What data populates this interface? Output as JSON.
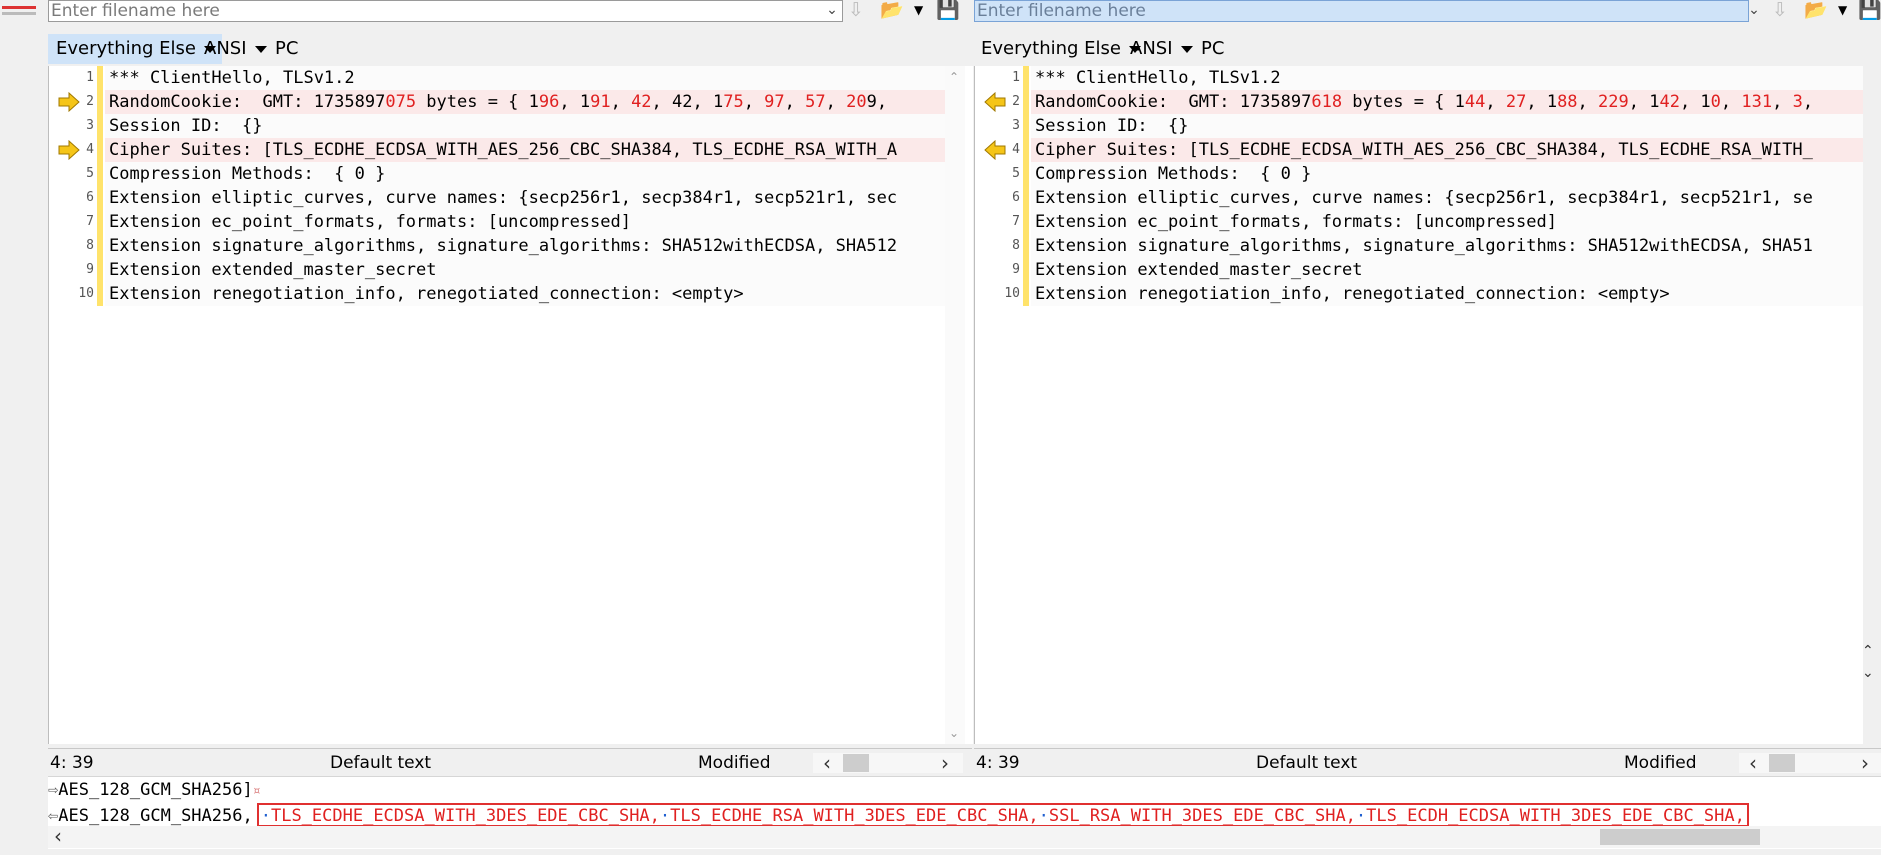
{
  "left": {
    "filename_placeholder": "Enter filename here",
    "filter": "Everything Else",
    "encoding": "ANSI",
    "line_endings": "PC",
    "status": {
      "position": "4: 39",
      "syntax": "Default text",
      "state": "Modified"
    },
    "lines": [
      {
        "num": "1",
        "segments": [
          {
            "t": "*** ClientHello, TLSv1.2",
            "r": false
          }
        ],
        "diff": false
      },
      {
        "num": "2",
        "segments": [
          {
            "t": "RandomCookie:  GMT: 1735897",
            "r": false
          },
          {
            "t": "075",
            "r": true
          },
          {
            "t": " bytes = { 1",
            "r": false
          },
          {
            "t": "96",
            "r": true
          },
          {
            "t": ", 1",
            "r": false
          },
          {
            "t": "91",
            "r": true
          },
          {
            "t": ", ",
            "r": false
          },
          {
            "t": "42",
            "r": true
          },
          {
            "t": ", 42, 1",
            "r": false
          },
          {
            "t": "75",
            "r": true
          },
          {
            "t": ", ",
            "r": false
          },
          {
            "t": "97",
            "r": true
          },
          {
            "t": ", ",
            "r": false
          },
          {
            "t": "57",
            "r": true
          },
          {
            "t": ", ",
            "r": false
          },
          {
            "t": "20",
            "r": true
          },
          {
            "t": "9,",
            "r": false
          }
        ],
        "diff": true
      },
      {
        "num": "3",
        "segments": [
          {
            "t": "Session ID:  {}",
            "r": false
          }
        ],
        "diff": false
      },
      {
        "num": "4",
        "segments": [
          {
            "t": "Cipher Suites: [TLS_ECDHE_ECDSA_WITH_AES_256_CBC_SHA384, TLS_ECDHE_RSA_WITH_A",
            "r": false
          }
        ],
        "diff": true
      },
      {
        "num": "5",
        "segments": [
          {
            "t": "Compression Methods:  { 0 }",
            "r": false
          }
        ],
        "diff": false
      },
      {
        "num": "6",
        "segments": [
          {
            "t": "Extension elliptic_curves, curve names: {secp256r1, secp384r1, secp521r1, sec",
            "r": false
          }
        ],
        "diff": false
      },
      {
        "num": "7",
        "segments": [
          {
            "t": "Extension ec_point_formats, formats: [uncompressed]",
            "r": false
          }
        ],
        "diff": false
      },
      {
        "num": "8",
        "segments": [
          {
            "t": "Extension signature_algorithms, signature_algorithms: SHA512withECDSA, SHA512",
            "r": false
          }
        ],
        "diff": false
      },
      {
        "num": "9",
        "segments": [
          {
            "t": "Extension extended_master_secret",
            "r": false
          }
        ],
        "diff": false
      },
      {
        "num": "10",
        "segments": [
          {
            "t": "Extension renegotiation_info, renegotiated_connection: <empty>",
            "r": false
          }
        ],
        "diff": false
      }
    ]
  },
  "right": {
    "filename_placeholder": "Enter filename here",
    "filter": "Everything Else",
    "encoding": "ANSI",
    "line_endings": "PC",
    "status": {
      "position": "4: 39",
      "syntax": "Default text",
      "state": "Modified"
    },
    "lines": [
      {
        "num": "1",
        "segments": [
          {
            "t": "*** ClientHello, TLSv1.2",
            "r": false
          }
        ],
        "diff": false
      },
      {
        "num": "2",
        "segments": [
          {
            "t": "RandomCookie:  GMT: 1735897",
            "r": false
          },
          {
            "t": "618",
            "r": true
          },
          {
            "t": " bytes = { 1",
            "r": false
          },
          {
            "t": "44",
            "r": true
          },
          {
            "t": ", ",
            "r": false
          },
          {
            "t": "27",
            "r": true
          },
          {
            "t": ", 1",
            "r": false
          },
          {
            "t": "88",
            "r": true
          },
          {
            "t": ", ",
            "r": false
          },
          {
            "t": "229",
            "r": true
          },
          {
            "t": ", 1",
            "r": false
          },
          {
            "t": "42",
            "r": true
          },
          {
            "t": ", 1",
            "r": false
          },
          {
            "t": "0",
            "r": true
          },
          {
            "t": ", ",
            "r": false
          },
          {
            "t": "131",
            "r": true
          },
          {
            "t": ", ",
            "r": false
          },
          {
            "t": "3",
            "r": true
          },
          {
            "t": ",",
            "r": false
          }
        ],
        "diff": true
      },
      {
        "num": "3",
        "segments": [
          {
            "t": "Session ID:  {}",
            "r": false
          }
        ],
        "diff": false
      },
      {
        "num": "4",
        "segments": [
          {
            "t": "Cipher Suites: [TLS_ECDHE_ECDSA_WITH_AES_256_CBC_SHA384, TLS_ECDHE_RSA_WITH_",
            "r": false
          }
        ],
        "diff": true
      },
      {
        "num": "5",
        "segments": [
          {
            "t": "Compression Methods:  { 0 }",
            "r": false
          }
        ],
        "diff": false
      },
      {
        "num": "6",
        "segments": [
          {
            "t": "Extension elliptic_curves, curve names: {secp256r1, secp384r1, secp521r1, se",
            "r": false
          }
        ],
        "diff": false
      },
      {
        "num": "7",
        "segments": [
          {
            "t": "Extension ec_point_formats, formats: [uncompressed]",
            "r": false
          }
        ],
        "diff": false
      },
      {
        "num": "8",
        "segments": [
          {
            "t": "Extension signature_algorithms, signature_algorithms: SHA512withECDSA, SHA51",
            "r": false
          }
        ],
        "diff": false
      },
      {
        "num": "9",
        "segments": [
          {
            "t": "Extension extended_master_secret",
            "r": false
          }
        ],
        "diff": false
      },
      {
        "num": "10",
        "segments": [
          {
            "t": "Extension renegotiation_info, renegotiated_connection: <empty>",
            "r": false
          }
        ],
        "diff": false
      }
    ]
  },
  "detail": {
    "line1": "AES_128_GCM_SHA256]",
    "line1_end": "¤",
    "line2_prefix": "AES_128_GCM_SHA256,",
    "line2_boxed": [
      "TLS_ECDHE_ECDSA_WITH_3DES_EDE_CBC_SHA,",
      "TLS_ECDHE_RSA_WITH_3DES_EDE_CBC_SHA,",
      "SSL_RSA_WITH_3DES_EDE_CBC_SHA,",
      "TLS_ECDH_ECDSA_WITH_3DES_EDE_CBC_SHA,"
    ]
  },
  "colors": {
    "diff_text": "#e02020",
    "diff_row": "#fbe9e9",
    "marker": "#ffe36b",
    "highlight": "#cfe3f8"
  },
  "icons": [
    "app-icon",
    "dropdown-arrow-icon",
    "merge-arrow-icon",
    "folder-open-icon",
    "save-icon",
    "right-arrow-icon",
    "left-arrow-icon"
  ]
}
